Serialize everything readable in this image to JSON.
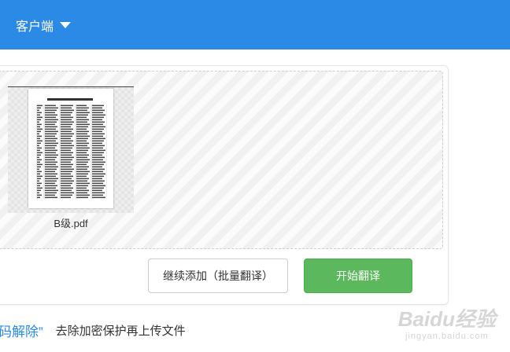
{
  "header": {
    "client_menu_label": "客户端",
    "background_color": "#2b8ae6"
  },
  "upload": {
    "file": {
      "name": "B级.pdf",
      "thumbnail_icon": "pdf-page-thumbnail"
    }
  },
  "actions": {
    "continue_add_label": "继续添加（批量翻译）",
    "start_translate_label": "开始翻译",
    "start_color": "#5cb85c"
  },
  "hint": {
    "link_text": "码解除”",
    "text": "去除加密保护再上传文件"
  },
  "watermark": {
    "text": "Baidu经验",
    "sub": "jingyan.baidu.com"
  }
}
